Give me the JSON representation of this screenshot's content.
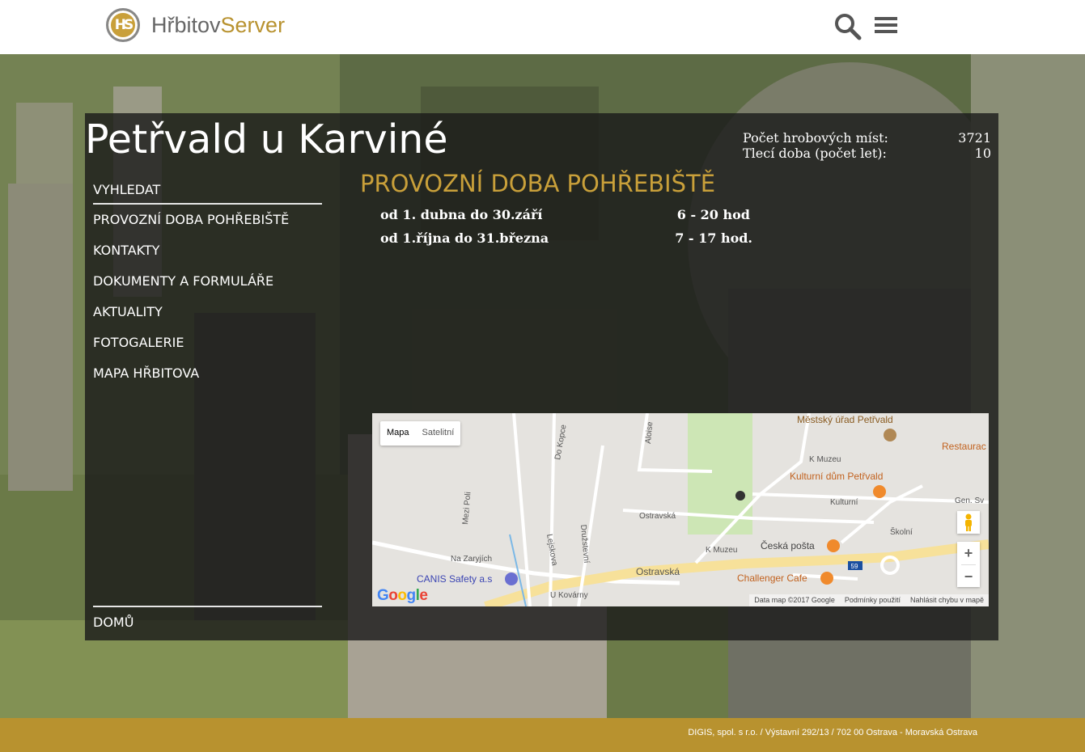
{
  "header": {
    "logo_mark": "HS",
    "logo_text_1": "Hřbitov",
    "logo_text_2": "Server"
  },
  "cemetery": {
    "title": "Petřvald u Karviné",
    "stats": [
      {
        "label": "Počet hrobových míst:",
        "value": "3721"
      },
      {
        "label": "Tlecí doba (počet let):",
        "value": "10"
      }
    ]
  },
  "nav": {
    "items": [
      "VYHLEDAT",
      "PROVOZNÍ DOBA POHŘEBIŠTĚ",
      "KONTAKTY",
      "DOKUMENTY A FORMULÁŘE",
      "AKTUALITY",
      "FOTOGALERIE",
      "MAPA HŘBITOVA"
    ],
    "home": "DOMŮ"
  },
  "opening_hours": {
    "title": "PROVOZNÍ DOBA POHŘEBIŠTĚ",
    "rows": [
      {
        "period": "od 1. dubna do 30.září",
        "hours": "6 - 20 hod"
      },
      {
        "period": "od 1.října do 31.března",
        "hours": "7 - 17 hod."
      }
    ]
  },
  "map": {
    "type_map": "Mapa",
    "type_satellite": "Satelitní",
    "zoom_in": "+",
    "zoom_out": "−",
    "google": "Google",
    "attribution": [
      "Data map ©2017 Google",
      "Podmínky použití",
      "Nahlásit chybu v mapě"
    ],
    "labels": {
      "mestsky_urad": "Městský úřad Petřvald",
      "restaurace": "Restaurac",
      "kulturni_dum": "Kulturní dům Petřvald",
      "kulturni": "Kulturní",
      "gen_sv": "Gen. Sv",
      "ostravska1": "Ostravská",
      "ostravska2": "Ostravská",
      "ceska_posta": "Česká pošta",
      "skolni": "Školní",
      "k_muzeu1": "K Muzeu",
      "k_muzeu2": "K Muzeu",
      "challenger": "Challenger Cafe",
      "canis": "CANIS Safety a.s",
      "na_zarijich": "Na Zaryjích",
      "u_kovarny": "U Kovárny",
      "mezi_poli": "Mezi Poli",
      "do_kopce": "Do Kopce",
      "aloise": "Aloise",
      "lejskova": "Lejskova",
      "druzstevni": "Družstevní",
      "road_59": "59"
    }
  },
  "footer": {
    "text": "DIGIS, spol. s r.o. / Výstavní 292/13 / 702 00 Ostrava - Moravská Ostrava"
  },
  "colors": {
    "accent_gold": "#b8922f",
    "title_gold": "#c9a03a",
    "panel_bg": "rgba(25,25,25,0.80)"
  }
}
